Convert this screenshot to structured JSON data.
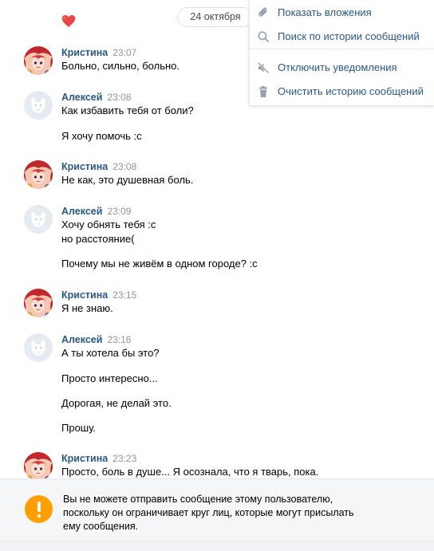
{
  "header": {
    "date": "24 октября"
  },
  "menu": {
    "items": [
      {
        "icon": "paperclip-icon",
        "label": "Показать вложения"
      },
      {
        "icon": "search-icon",
        "label": "Поиск по истории сообщений"
      },
      {
        "icon": "mute-icon",
        "label": "Отключить уведомления"
      },
      {
        "icon": "trash-icon",
        "label": "Очистить историю сообщений"
      }
    ]
  },
  "messages": [
    {
      "author": "Кристина",
      "time": "23:07",
      "avatar": "kristina-avatar",
      "lines": [
        "Больно, сильно, больно."
      ]
    },
    {
      "author": "Алексей",
      "time": "23:08",
      "avatar": "aleksey-avatar",
      "lines": [
        "Как избавить тебя от боли?",
        "Я хочу помочь :с"
      ]
    },
    {
      "author": "Кристина",
      "time": "23:08",
      "avatar": "kristina-avatar",
      "lines": [
        "Не как, это душевная боль."
      ]
    },
    {
      "author": "Алексей",
      "time": "23:09",
      "avatar": "aleksey-avatar",
      "lines": [
        "Хочу обнять тебя :с",
        "но расстояние(",
        "Почему мы не живём в одном городе? :с"
      ]
    },
    {
      "author": "Кристина",
      "time": "23:15",
      "avatar": "kristina-avatar",
      "lines": [
        "Я не знаю."
      ]
    },
    {
      "author": "Алексей",
      "time": "23:16",
      "avatar": "aleksey-avatar",
      "lines": [
        "А ты хотела бы это?",
        "Просто интересно...",
        "Дорогая, не делай это.",
        "Прошу."
      ]
    },
    {
      "author": "Кристина",
      "time": "23:23",
      "avatar": "kristina-avatar",
      "lines": [
        "Просто, боль в душе... Я осознала, что я тварь, пока."
      ]
    }
  ],
  "notice": {
    "lines": [
      "Вы не можете отправить сообщение этому пользователю,",
      "поскольку он ограничивает круг лиц, которые могут присылать",
      "ему сообщения."
    ]
  },
  "colors": {
    "author_name": "#2a5885",
    "timestamp": "#939393",
    "menu_text": "#2a5885",
    "warning": "#ffa000",
    "heart": "#e64646"
  }
}
